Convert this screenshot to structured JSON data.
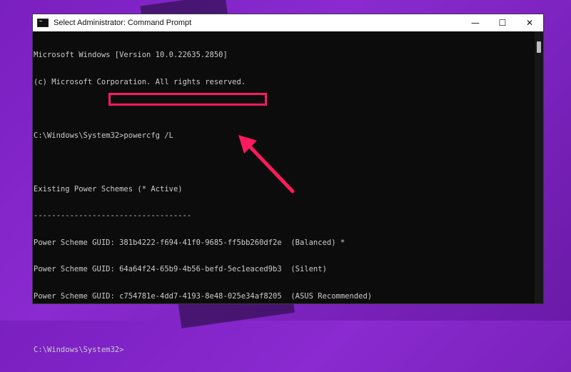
{
  "window": {
    "title": "Select Administrator: Command Prompt",
    "controls": {
      "minimize": "—",
      "maximize": "☐",
      "close": "✕"
    }
  },
  "console": {
    "lines": [
      "Microsoft Windows [Version 10.0.22635.2850]",
      "(c) Microsoft Corporation. All rights reserved.",
      "",
      "C:\\Windows\\System32>powercfg /L",
      "",
      "Existing Power Schemes (* Active)",
      "-----------------------------------",
      "Power Scheme GUID: 381b4222-f694-41f0-9685-ff5bb260df2e  (Balanced) *",
      "Power Scheme GUID: 64a64f24-65b9-4b56-befd-5ec1eaced9b3  (Silent)",
      "Power Scheme GUID: c754781e-4dd7-4193-8e48-025e34af8205  (ASUS Recommended)",
      "",
      "C:\\Windows\\System32>"
    ]
  },
  "annotation": {
    "color": "#ff1a5e"
  }
}
